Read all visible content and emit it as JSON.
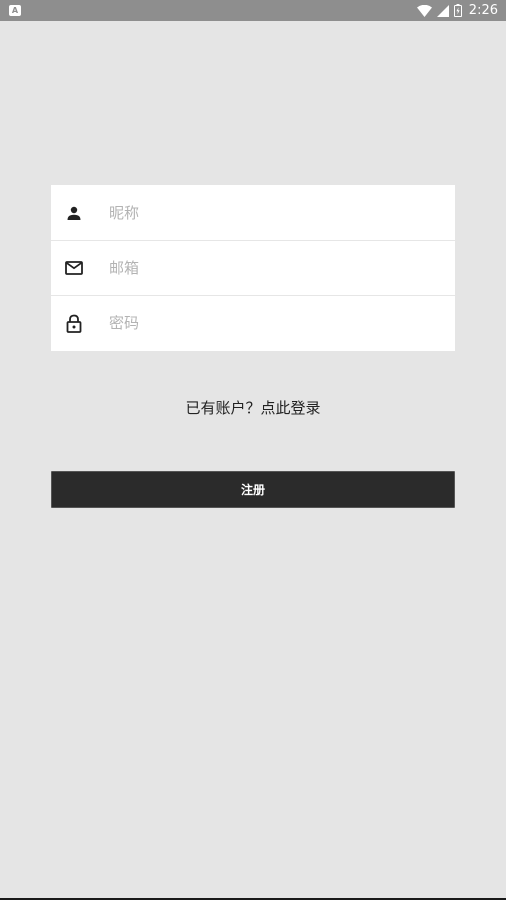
{
  "status_bar": {
    "app_icon_letter": "A",
    "time": "2:26",
    "icons": [
      "wifi-icon",
      "signal-icon",
      "battery-icon"
    ]
  },
  "form": {
    "fields": [
      {
        "icon": "person-icon",
        "placeholder": "昵称",
        "value": ""
      },
      {
        "icon": "mail-icon",
        "placeholder": "邮箱",
        "value": ""
      },
      {
        "icon": "lock-icon",
        "placeholder": "密码",
        "value": ""
      }
    ]
  },
  "login_link": "已有账户？点此登录",
  "register_button": "注册",
  "colors": {
    "background": "#e5e5e5",
    "status_bar": "#8e8e8e",
    "button": "#2b2b2b",
    "placeholder": "#b3b3b3"
  }
}
